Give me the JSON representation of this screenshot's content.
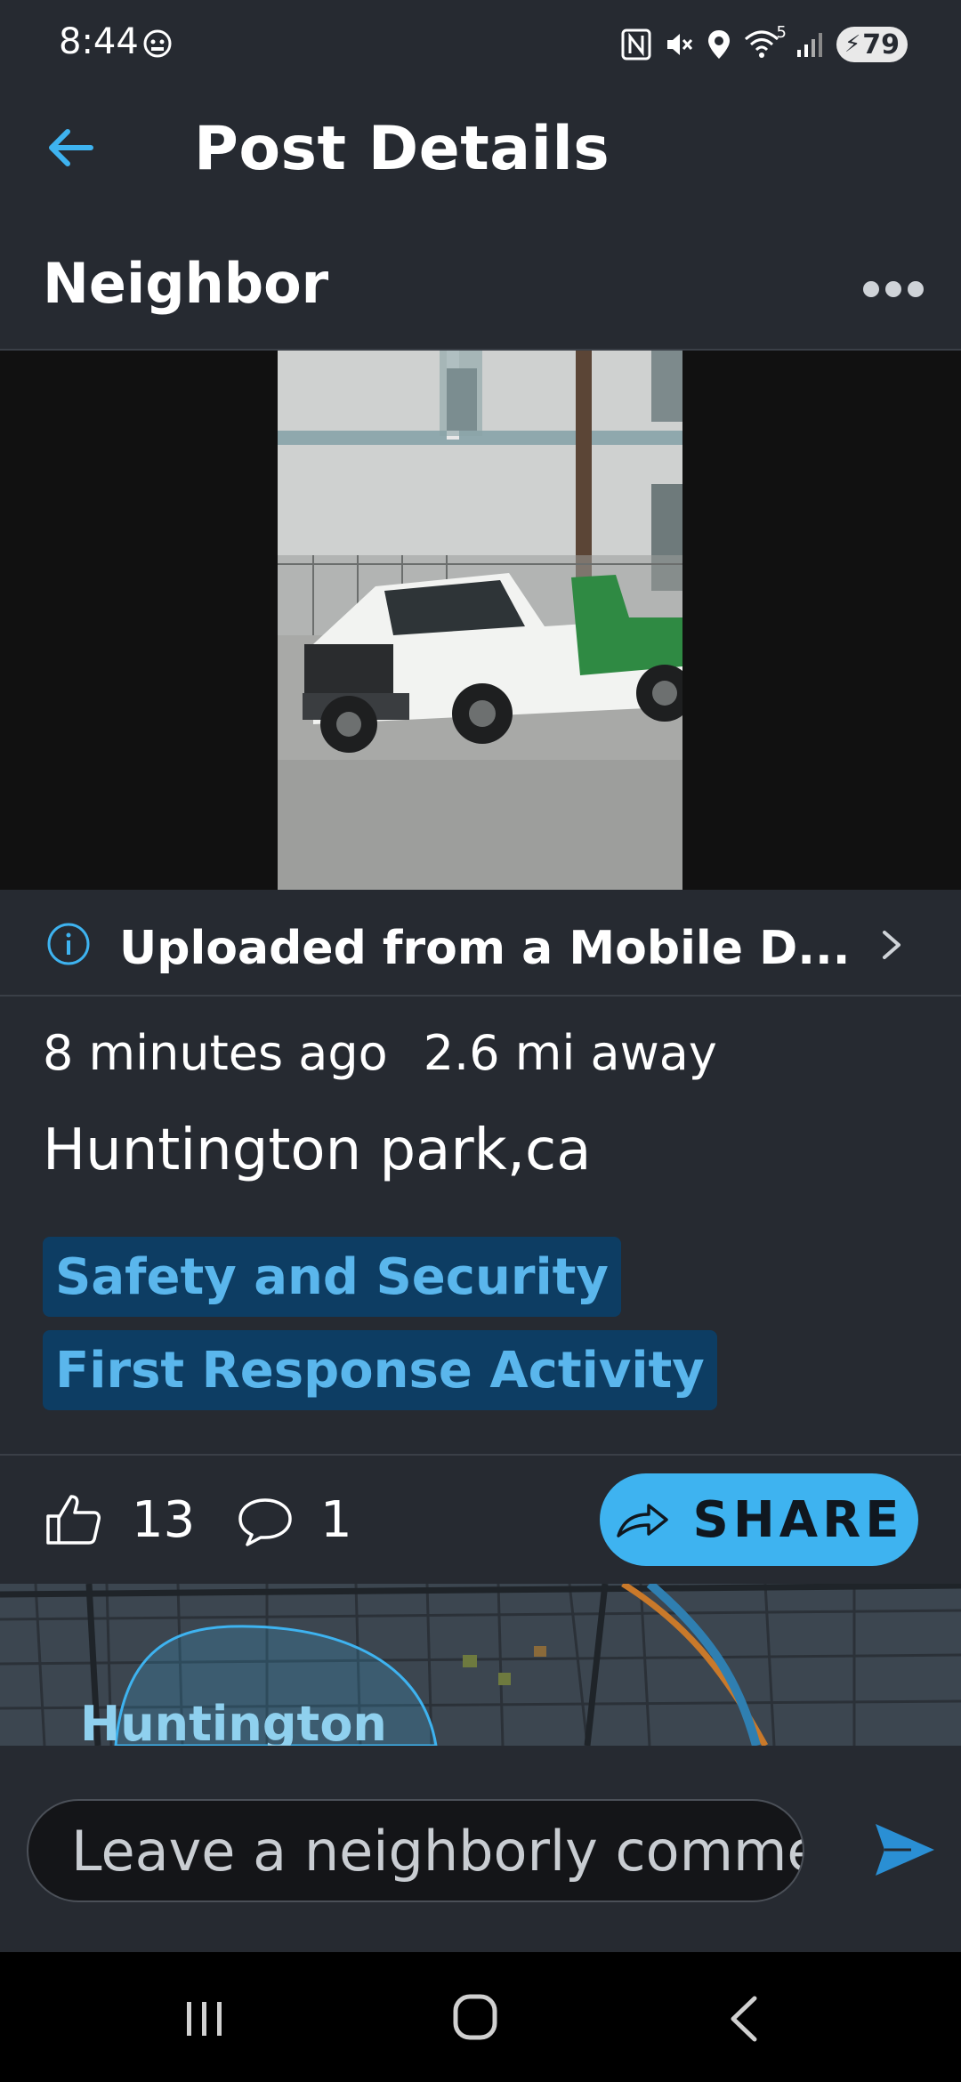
{
  "status_bar": {
    "time": "8:44",
    "network_label": "5",
    "battery": "79",
    "icons": [
      "face-widget-icon",
      "nfc-icon",
      "mute-icon",
      "location-icon",
      "wifi-icon",
      "signal-icon",
      "battery-icon"
    ]
  },
  "header": {
    "title": "Post Details",
    "back_icon": "back-arrow-icon"
  },
  "post": {
    "author": "Neighbor",
    "more_icon": "more-dots-icon",
    "media_description_icon": "photo",
    "upload_info": "Uploaded from a Mobile D...",
    "time_ago": "8 minutes ago",
    "distance": "2.6 mi away",
    "location": "Huntington park,ca",
    "tags": [
      "Safety and Security",
      "First Response Activity"
    ],
    "likes": "13",
    "comments": "1",
    "share_label": "SHARE"
  },
  "map": {
    "label": "Huntington"
  },
  "comment_box": {
    "placeholder": "Leave a neighborly comment"
  },
  "colors": {
    "background": "#262a31",
    "accent": "#3eb3f0",
    "tag_bg": "#0d3d63",
    "tag_text": "#5ab6ec"
  }
}
